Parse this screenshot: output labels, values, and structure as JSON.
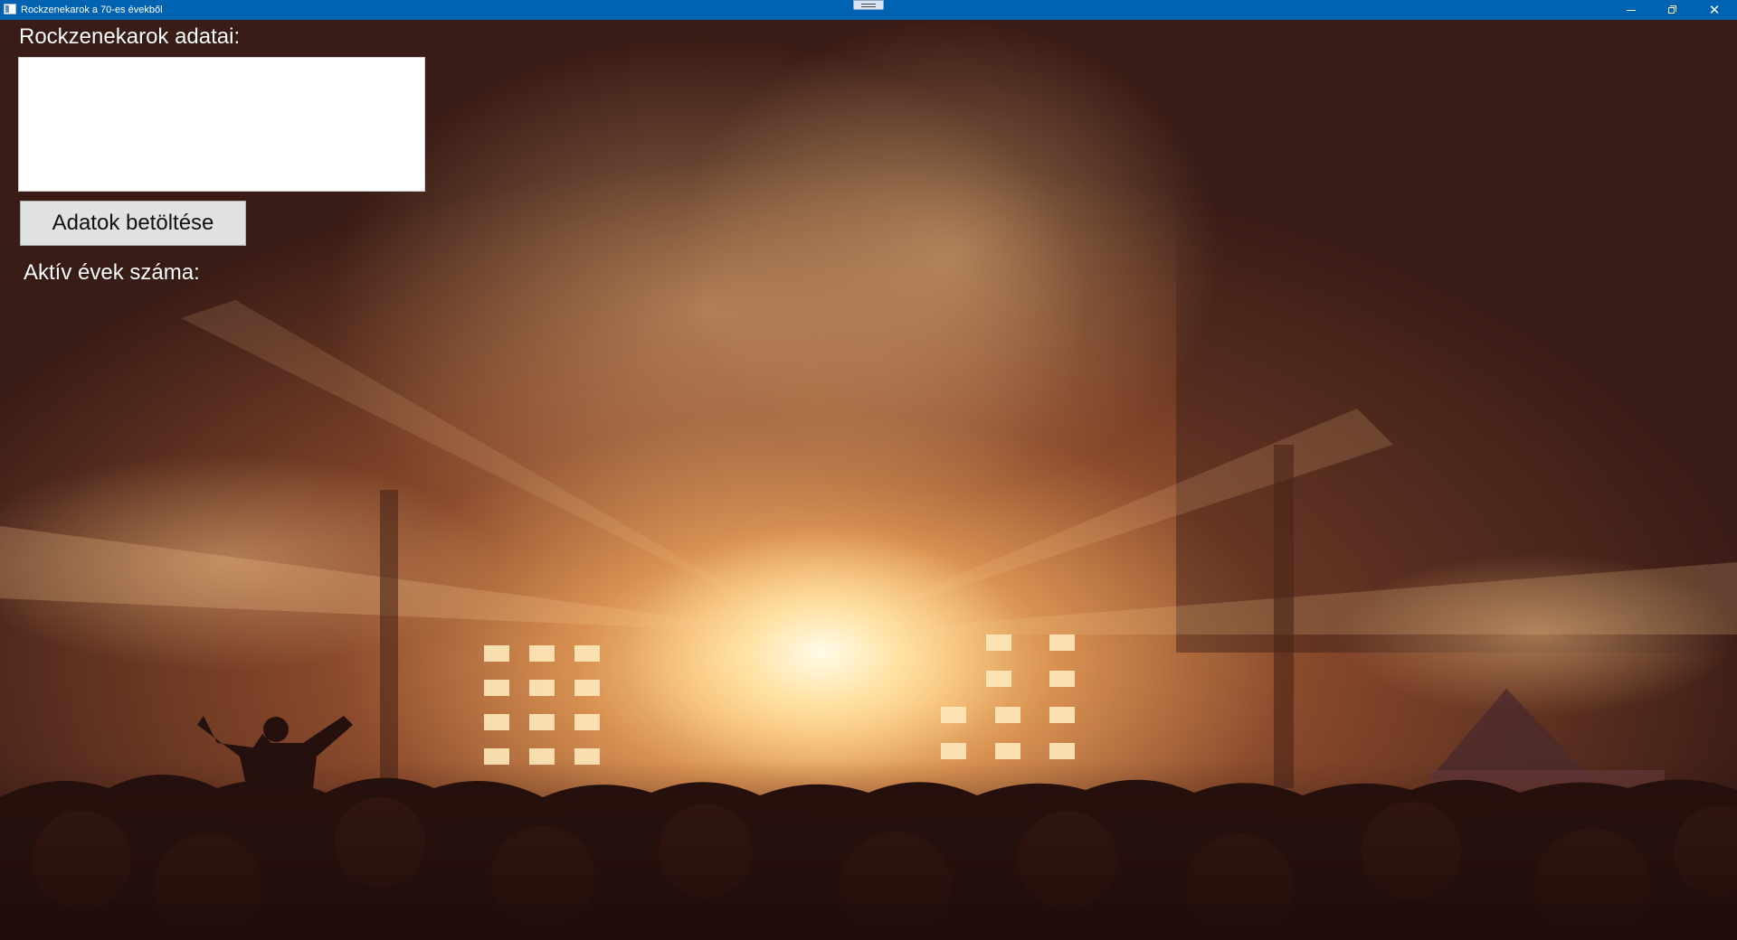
{
  "window": {
    "title": "Rockzenekarok a 70-es évekből",
    "app_icon": "window-app-icon",
    "controls": {
      "minimize_icon": "minimize-icon",
      "restore_icon": "restore-icon",
      "close_icon": "close-icon"
    }
  },
  "main": {
    "bands_label": "Rockzenekarok adatai:",
    "bands_box_value": "",
    "load_button_label": "Adatok betöltése",
    "active_years_label": "Aktív évek száma:"
  },
  "background": {
    "image": "concert-crowd-stage-lights",
    "tint": "#7a3f22"
  }
}
